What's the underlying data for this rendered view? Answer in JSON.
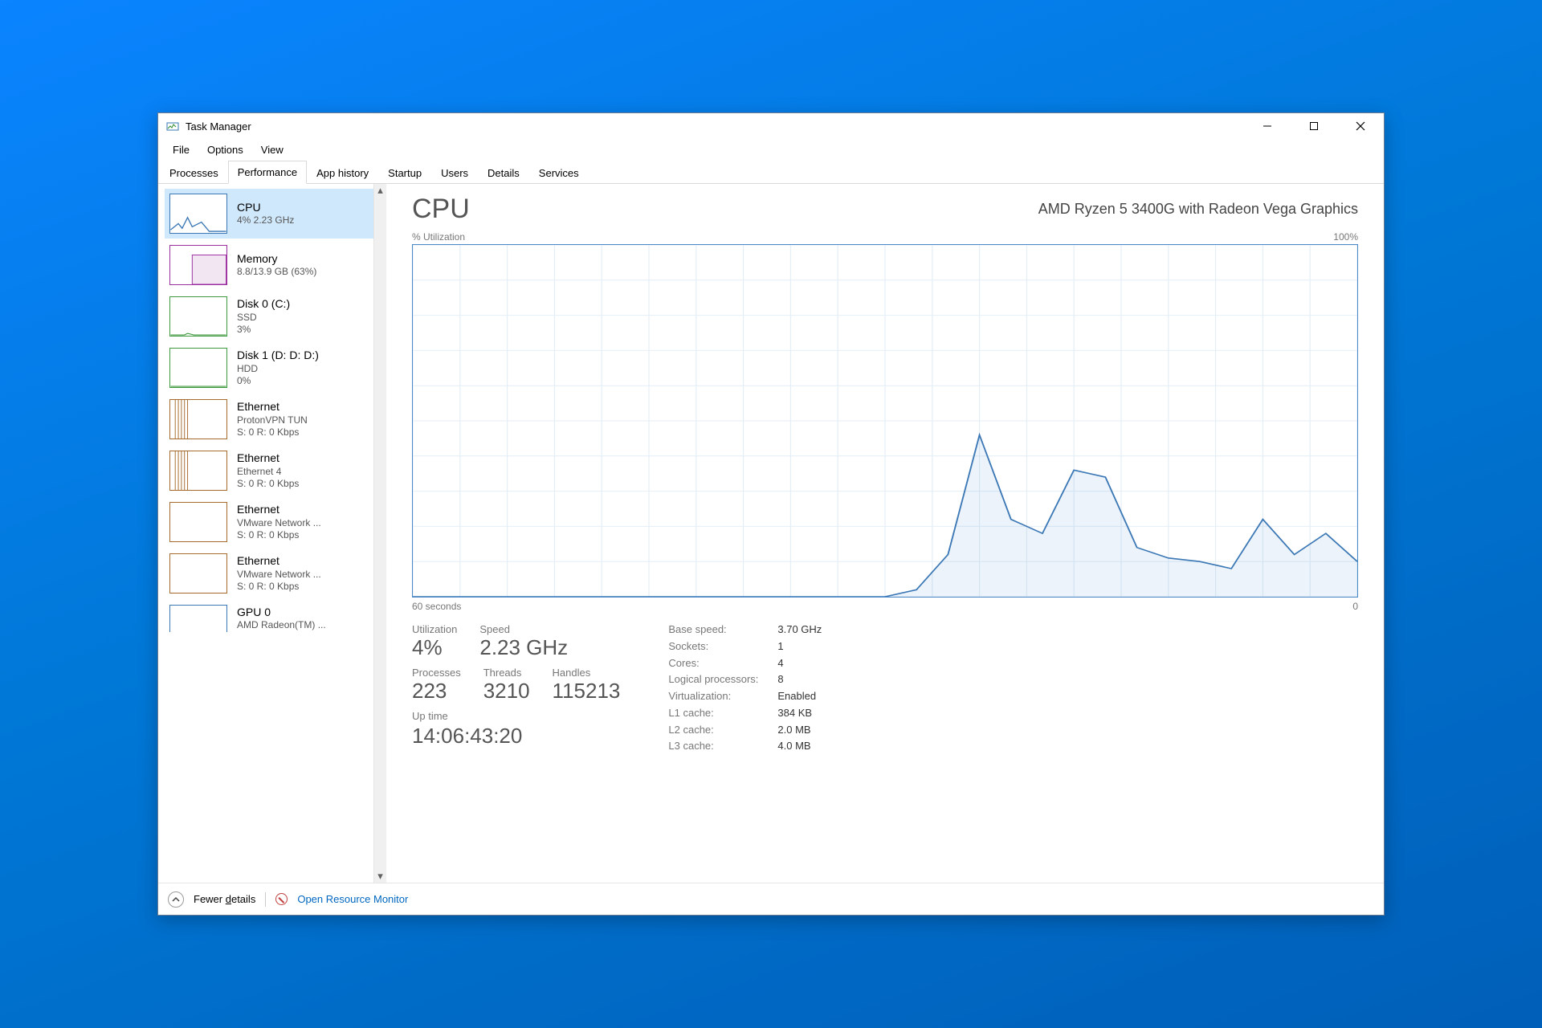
{
  "window": {
    "title": "Task Manager",
    "controls": {
      "minimize": "minimize",
      "maximize": "maximize",
      "close": "close"
    }
  },
  "menu": {
    "file": "File",
    "options": "Options",
    "view": "View"
  },
  "tabs": {
    "processes": "Processes",
    "performance": "Performance",
    "app_history": "App history",
    "startup": "Startup",
    "users": "Users",
    "details": "Details",
    "services": "Services",
    "active": "performance"
  },
  "sidebar": [
    {
      "title": "CPU",
      "sub1": "4% 2.23 GHz",
      "color": "#3b78b5",
      "thumb": "cpu",
      "selected": true
    },
    {
      "title": "Memory",
      "sub1": "8.8/13.9 GB (63%)",
      "color": "#9b2fa0",
      "thumb": "mem"
    },
    {
      "title": "Disk 0 (C:)",
      "sub1": "SSD",
      "sub2": "3%",
      "color": "#3f9a3f",
      "thumb": "disk"
    },
    {
      "title": "Disk 1 (D: D: D:)",
      "sub1": "HDD",
      "sub2": "0%",
      "color": "#3f9a3f",
      "thumb": "disk2"
    },
    {
      "title": "Ethernet",
      "sub1": "ProtonVPN TUN",
      "sub2": "S: 0 R: 0 Kbps",
      "color": "#a56a2e",
      "thumb": "eth1"
    },
    {
      "title": "Ethernet",
      "sub1": "Ethernet 4",
      "sub2": "S: 0 R: 0 Kbps",
      "color": "#a56a2e",
      "thumb": "eth1"
    },
    {
      "title": "Ethernet",
      "sub1": "VMware Network ...",
      "sub2": "S: 0 R: 0 Kbps",
      "color": "#a56a2e",
      "thumb": "blank"
    },
    {
      "title": "Ethernet",
      "sub1": "VMware Network ...",
      "sub2": "S: 0 R: 0 Kbps",
      "color": "#a56a2e",
      "thumb": "blank"
    },
    {
      "title": "GPU 0",
      "sub1": "AMD Radeon(TM) ...",
      "color": "#3b78b5",
      "thumb": "blank_top"
    }
  ],
  "main": {
    "title": "CPU",
    "device": "AMD Ryzen 5 3400G with Radeon Vega Graphics",
    "chart_top_left": "% Utilization",
    "chart_top_right": "100%",
    "chart_bottom_left": "60 seconds",
    "chart_bottom_right": "0",
    "stats": {
      "utilization_label": "Utilization",
      "utilization": "4%",
      "speed_label": "Speed",
      "speed": "2.23 GHz",
      "processes_label": "Processes",
      "processes": "223",
      "threads_label": "Threads",
      "threads": "3210",
      "handles_label": "Handles",
      "handles": "115213",
      "uptime_label": "Up time",
      "uptime": "14:06:43:20"
    },
    "info": {
      "base_speed_k": "Base speed:",
      "base_speed_v": "3.70 GHz",
      "sockets_k": "Sockets:",
      "sockets_v": "1",
      "cores_k": "Cores:",
      "cores_v": "4",
      "logical_k": "Logical processors:",
      "logical_v": "8",
      "virt_k": "Virtualization:",
      "virt_v": "Enabled",
      "l1_k": "L1 cache:",
      "l1_v": "384 KB",
      "l2_k": "L2 cache:",
      "l2_v": "2.0 MB",
      "l3_k": "L3 cache:",
      "l3_v": "4.0 MB"
    }
  },
  "footer": {
    "fewer_prefix": "Fewer ",
    "fewer_letter": "d",
    "fewer_suffix": "etails",
    "resource_monitor": "Open Resource Monitor"
  },
  "chart_data": {
    "type": "line",
    "title": "CPU % Utilization",
    "xlabel": "seconds ago",
    "ylabel": "% Utilization",
    "ylim": [
      0,
      100
    ],
    "xlim": [
      60,
      0
    ],
    "x": [
      60,
      58,
      56,
      54,
      52,
      50,
      48,
      46,
      44,
      42,
      40,
      38,
      36,
      34,
      32,
      30,
      28,
      26,
      24,
      22,
      20,
      18,
      16,
      14,
      12,
      10,
      8,
      6,
      4,
      2,
      0
    ],
    "values": [
      0,
      0,
      0,
      0,
      0,
      0,
      0,
      0,
      0,
      0,
      0,
      0,
      0,
      0,
      0,
      0,
      2,
      12,
      46,
      22,
      18,
      36,
      34,
      14,
      11,
      10,
      8,
      22,
      12,
      18,
      10
    ]
  }
}
